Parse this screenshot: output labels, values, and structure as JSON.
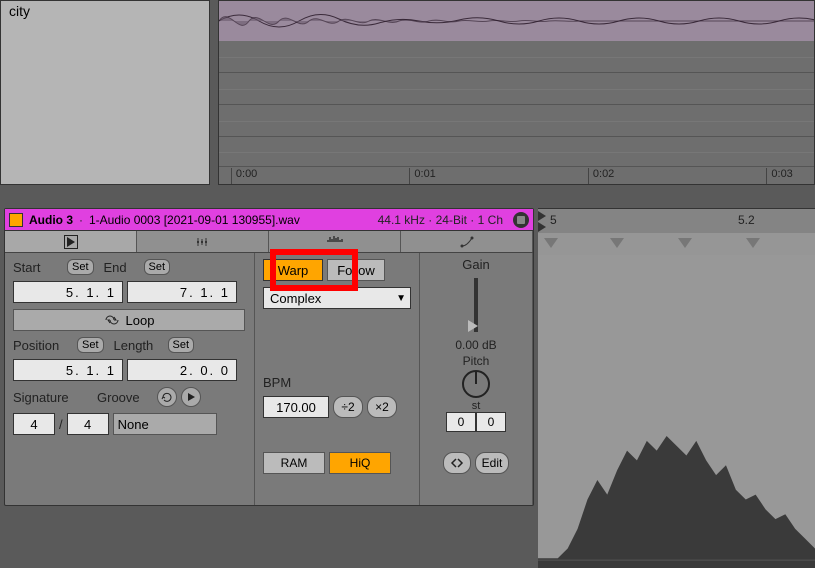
{
  "topLeft": {
    "label": "city"
  },
  "timeline": {
    "ticks": [
      "0:00",
      "0:01",
      "0:02",
      "0:03"
    ]
  },
  "clip": {
    "name": "Audio 3",
    "filename": "1-Audio 0003 [2021-09-01 130955].wav",
    "info": "44.1 kHz · 24-Bit · 1 Ch"
  },
  "sample": {
    "startLabel": "Start",
    "endLabel": "End",
    "setLabel": "Set",
    "startVal": "5.   1.   1",
    "endVal": "7.   1.   1",
    "loopLabel": "Loop",
    "positionLabel": "Position",
    "lengthLabel": "Length",
    "posVal": "5.   1.   1",
    "lenVal": "2.   0.   0",
    "signatureLabel": "Signature",
    "grooveLabel": "Groove",
    "sigNum": "4",
    "sigDen": "4",
    "grooveVal": "None"
  },
  "warp": {
    "warpLabel": "Warp",
    "followLabel": "Follow",
    "modeLabel": "Complex",
    "bpmLabel": "BPM",
    "bpmVal": "170.00",
    "halfLabel": "÷2",
    "doubleLabel": "×2",
    "ramLabel": "RAM",
    "hiqLabel": "HiQ"
  },
  "gain": {
    "gainLabel": "Gain",
    "gainVal": "0.00 dB",
    "pitchLabel": "Pitch",
    "stLabel": "st",
    "coarse": "0",
    "fine": "0",
    "editLabel": "Edit"
  },
  "ruler": {
    "ticks": [
      "5",
      "5.2"
    ]
  }
}
